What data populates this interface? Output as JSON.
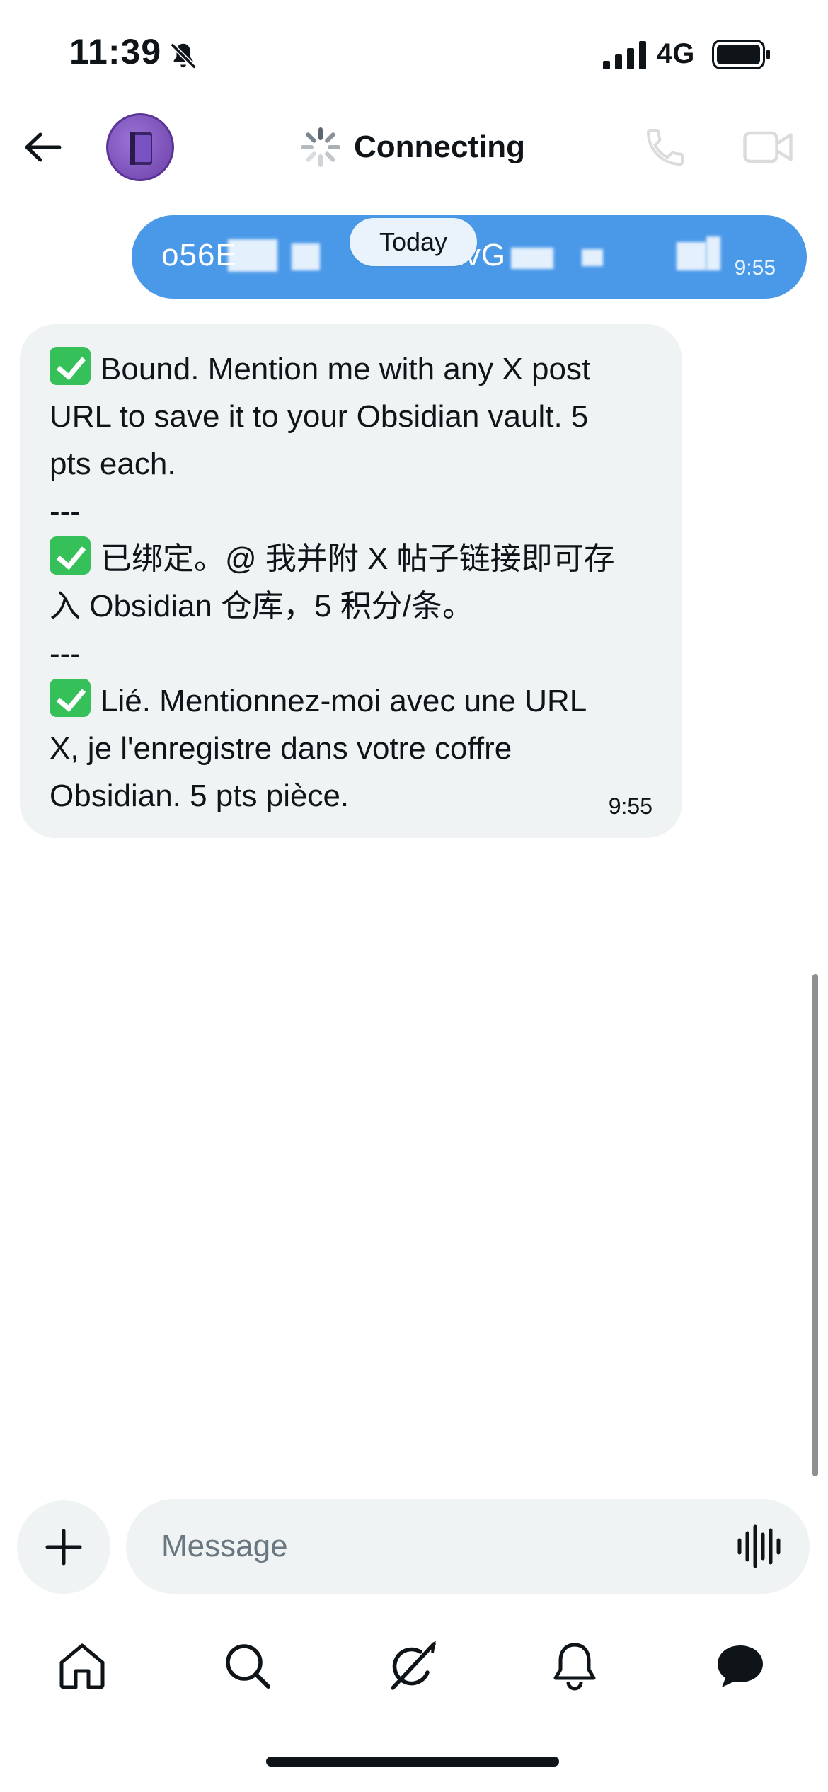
{
  "status_bar": {
    "time": "11:39",
    "network": "4G",
    "icons": [
      "bell-slash-icon",
      "signal-icon",
      "battery-icon"
    ]
  },
  "header": {
    "title": "Connecting",
    "icons": [
      "back-arrow-icon",
      "avatar",
      "spinner-icon",
      "phone-icon",
      "video-icon"
    ]
  },
  "conversation": {
    "date_separator": "Today",
    "messages": [
      {
        "direction": "sent",
        "text": "o56E",
        "text_tail": "BVvdzvG",
        "time": "9:55"
      },
      {
        "direction": "received",
        "lines": [
          "Bound. Mention me with any X post",
          "URL to save it to your Obsidian vault. 5",
          "pts each.",
          "---",
          "已绑定。@ 我并附 X 帖子链接即可存",
          "入 Obsidian 仓库，5 积分/条。",
          "---",
          "Lié. Mentionnez-moi avec une URL",
          "X, je l'enregistre dans votre coffre",
          "Obsidian. 5 pts pièce."
        ],
        "time": "9:55"
      }
    ]
  },
  "composer": {
    "placeholder": "Message",
    "icons": [
      "plus-icon",
      "voice-wave-icon"
    ]
  },
  "tabbar": {
    "items": [
      "home-icon",
      "search-icon",
      "grok-icon",
      "bell-icon",
      "messages-icon"
    ],
    "active": "messages-icon"
  },
  "colors": {
    "sent_bubble": "#4a99e9",
    "received_bubble": "#eff3f4",
    "check_emoji": "#36c05a",
    "text": "#0f1419"
  }
}
